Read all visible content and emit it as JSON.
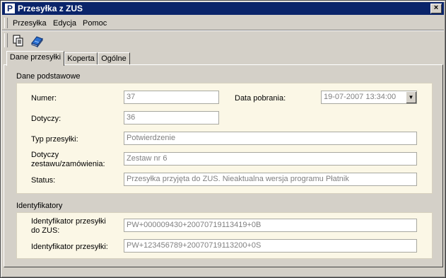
{
  "window": {
    "title": "Przesyłka z ZUS",
    "app_icon_letter": "P",
    "close_label": "×"
  },
  "menu": {
    "items": [
      "Przesyłka",
      "Edycja",
      "Pomoc"
    ]
  },
  "toolbar": {
    "buttons": [
      "copy-icon",
      "book-icon"
    ]
  },
  "tabs": [
    {
      "label": "Dane przesyłki",
      "active": true
    },
    {
      "label": "Koperta",
      "active": false
    },
    {
      "label": "Ogólne",
      "active": false
    }
  ],
  "basic": {
    "title": "Dane podstawowe",
    "numer": {
      "label": "Numer:",
      "value": "37"
    },
    "data_pobrania": {
      "label": "Data pobrania:",
      "value": "19-07-2007 13:34:00"
    },
    "dotyczy": {
      "label": "Dotyczy:",
      "value": "36"
    },
    "typ": {
      "label": "Typ przesyłki:",
      "value": "Potwierdzenie"
    },
    "zestaw": {
      "label_line1": "Dotyczy",
      "label_line2": "zestawu/zamówienia:",
      "value": "Zestaw nr 6"
    },
    "status": {
      "label": "Status:",
      "value": "Przesyłka przyjęta do ZUS. Nieaktualna wersja programu Płatnik"
    }
  },
  "ids": {
    "title": "Identyfikatory",
    "zus": {
      "label_line1": "Identyfikator przesyłki",
      "label_line2": "do ZUS:",
      "value": "PW+000009430+20070719113419+0B"
    },
    "local": {
      "label": "Identyfikator przesyłki:",
      "value": "PW+123456789+20070719113200+0S"
    }
  },
  "colors": {
    "titlebar": "#0a246a",
    "group_bg": "#fbf7e6",
    "window_bg": "#d4d0c8"
  }
}
